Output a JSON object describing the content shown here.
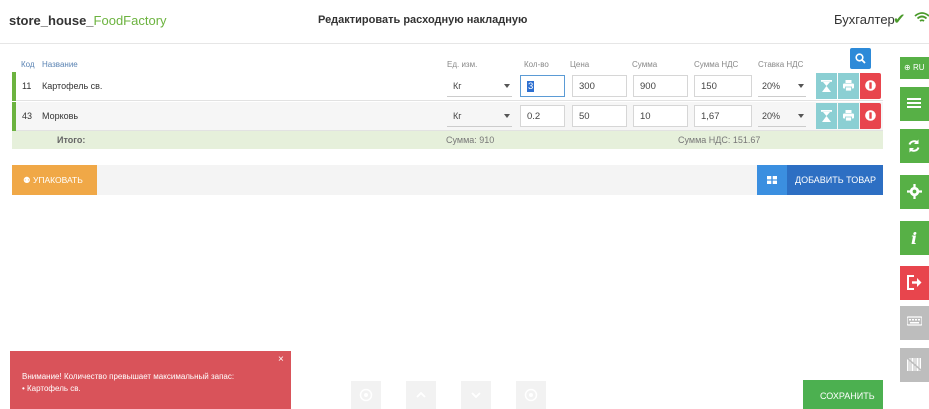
{
  "header": {
    "app_prefix": "store_house_",
    "app_accent": "FoodFactory",
    "page_title": "Редактировать расходную накладную",
    "role": "Бухгалтер"
  },
  "table": {
    "columns": {
      "code": "Код",
      "name": "Название",
      "unit": "Ед. изм.",
      "qty": "Кол-во",
      "price": "Цена",
      "sum": "Сумма",
      "vat_sum": "Сумма НДС",
      "vat_rate": "Ставка НДС"
    },
    "rows": [
      {
        "code": "11",
        "name": "Картофель св.",
        "unit": "Кг",
        "qty": "3",
        "price": "300",
        "sum": "900",
        "vat_sum": "150",
        "vat_rate": "20%"
      },
      {
        "code": "43",
        "name": "Морковь",
        "unit": "Кг",
        "qty": "0.2",
        "price": "50",
        "sum": "10",
        "vat_sum": "1,67",
        "vat_rate": "20%"
      }
    ],
    "total": {
      "label": "Итого:",
      "sum": "Сумма: 910",
      "vat": "Сумма НДС: 151.67"
    }
  },
  "buttons": {
    "pack": "УПАКОВАТЬ",
    "add_product": "ДОБАВИТЬ ТОВАР",
    "save": "СОХРАНИТЬ"
  },
  "sidebar": {
    "lang": "RU"
  },
  "alert": {
    "line1": "Внимание! Количество превышает максимальный запас:",
    "line2": "• Картофель св.",
    "close": "×"
  },
  "colors": {
    "accent_green": "#6cb33f",
    "primary_blue": "#2d6fc3",
    "danger_red": "#e8454d",
    "warning_orange": "#f0a847",
    "sidebar_icons": [
      "list-icon",
      "sync-icon",
      "gear-icon",
      "info-icon",
      "logout-icon",
      "keyboard-icon",
      "barcode-icon"
    ]
  }
}
